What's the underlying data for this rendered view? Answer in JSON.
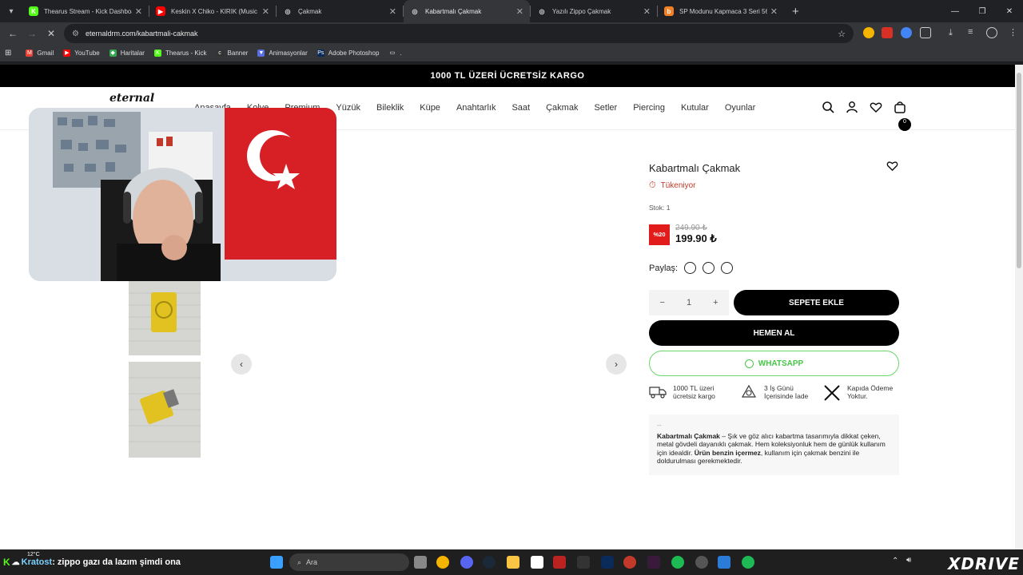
{
  "browser": {
    "tabs": [
      {
        "title": "Thearus Stream - Kick Dashboar",
        "fav_color": "#53fc18",
        "fav_letter": "K"
      },
      {
        "title": "Keskin X Chiko - KIRIK (Music V",
        "fav_color": "#ff0000",
        "fav_letter": "▶"
      },
      {
        "title": "Çakmak",
        "fav_color": "#ffffff",
        "fav_letter": "◎"
      },
      {
        "title": "Kabartmalı Çakmak",
        "fav_color": "#ffffff",
        "fav_letter": "◎"
      },
      {
        "title": "Yazılı Zippo Çakmak",
        "fav_color": "#ffffff",
        "fav_letter": "◎"
      },
      {
        "title": "SP Modunu Kapmaca 3 Seri 56",
        "fav_color": "#f48024",
        "fav_letter": "b"
      }
    ],
    "active_tab": 3,
    "url": "eternaldrm.com/kabartmali-cakmak",
    "bookmarks": [
      {
        "label": "Gmail",
        "color": "#ea4335",
        "icon": "M"
      },
      {
        "label": "YouTube",
        "color": "#ff0000",
        "icon": "▶"
      },
      {
        "label": "Haritalar",
        "color": "#34a853",
        "icon": "◆"
      },
      {
        "label": "Thearus - Kick",
        "color": "#53fc18",
        "icon": "K"
      },
      {
        "label": "Banner",
        "color": "#333333",
        "icon": "c"
      },
      {
        "label": "Animasyonlar",
        "color": "#5b6ee1",
        "icon": "▼"
      },
      {
        "label": "Adobe Photoshop",
        "color": "#0a2a5a",
        "icon": "Ps"
      },
      {
        "label": ".",
        "color": "#35363a",
        "icon": "▭"
      }
    ]
  },
  "site": {
    "promo": "1000 TL ÜZERİ ÜCRETSİZ KARGO",
    "logo": "eternal",
    "nav": [
      "Anasayfa",
      "Kolye",
      "Premium",
      "Yüzük",
      "Bileklik",
      "Küpe",
      "Anahtarlık",
      "Saat",
      "Çakmak",
      "Setler",
      "Piercing",
      "Kutular",
      "Oyunlar"
    ],
    "cart_count": "0"
  },
  "product": {
    "title": "Kabartmalı Çakmak",
    "low_stock": "Tükeniyor",
    "stock": "Stok: 1",
    "discount": "%20",
    "old_price": "249.90 ₺",
    "new_price": "199.90 ₺",
    "share_label": "Paylaş:",
    "quantity": "1",
    "add_to_cart": "SEPETE EKLE",
    "buy_now": "HEMEN AL",
    "whatsapp": "WHATSAPP",
    "features": [
      "1000 TL üzeri ücretsiz kargo",
      "3 İş Günü İçerisinde İade",
      "Kapıda Ödeme Yoktur."
    ],
    "desc_dash": "--",
    "desc_bold": "Kabartmalı Çakmak",
    "desc_1": " – Şık ve göz alıcı kabartma tasarımıyla dikkat çeken, metal gövdeli dayanıklı çakmak. Hem koleksiyonluk hem de günlük kullanım için idealdir. ",
    "desc_bold2": "Ürün benzin içermez",
    "desc_2": ", kullanım için çakmak benzini ile doldurulması gerekmektedir."
  },
  "taskbar": {
    "weather": "12°C",
    "chat_user": "Kratost",
    "chat_msg": ": zippo gazı da lazım şimdi ona",
    "search_placeholder": "Ara",
    "brand": "XDRIVE"
  }
}
